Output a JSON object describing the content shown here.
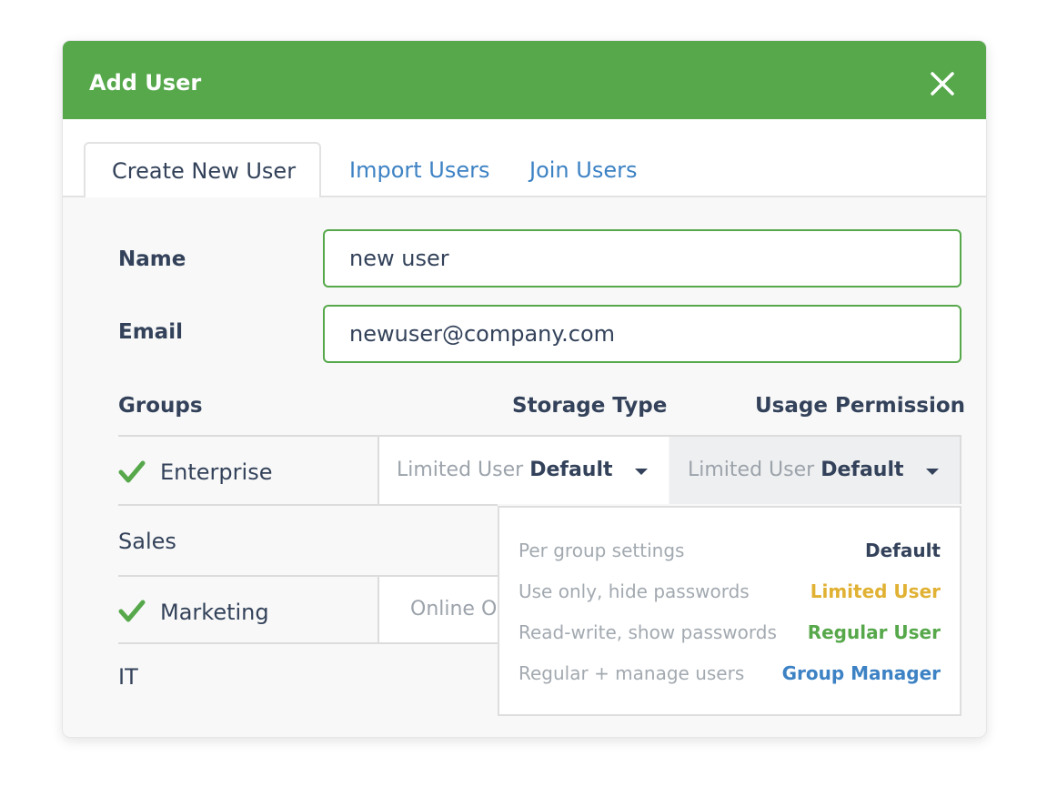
{
  "dialog": {
    "title": "Add User",
    "close_icon": "close-icon"
  },
  "tabs": [
    {
      "label": "Create New User",
      "active": true
    },
    {
      "label": "Import Users",
      "active": false
    },
    {
      "label": "Join Users",
      "active": false
    }
  ],
  "form": {
    "name_label": "Name",
    "name_value": "new user",
    "email_label": "Email",
    "email_value": "newuser@company.com"
  },
  "table": {
    "headers": {
      "groups": "Groups",
      "storage_type": "Storage Type",
      "usage_permission": "Usage Permission"
    },
    "rows": [
      {
        "name": "Enterprise",
        "checked": true,
        "storage": {
          "muted": "Limited User",
          "strong": "Default"
        },
        "permission": {
          "muted": "Limited User",
          "strong": "Default"
        }
      },
      {
        "name": "Sales",
        "checked": false
      },
      {
        "name": "Marketing",
        "checked": true,
        "storage": {
          "muted": "Online Or",
          "strong": ""
        }
      },
      {
        "name": "IT",
        "checked": false
      }
    ]
  },
  "permission_dropdown": {
    "options": [
      {
        "description": "Per group settings",
        "value": "Default",
        "color": "#33425a"
      },
      {
        "description": "Use only, hide passwords",
        "value": "Limited User",
        "color": "#e0b132"
      },
      {
        "description": "Read-write, show passwords",
        "value": "Regular User",
        "color": "#56a84b"
      },
      {
        "description": "Regular + manage users",
        "value": "Group Manager",
        "color": "#3d82c4"
      }
    ]
  },
  "colors": {
    "accent_green": "#56a84b",
    "link_blue": "#3d82c4",
    "text_dark": "#33425a",
    "text_muted": "#9ca3ab"
  },
  "icons": {
    "check": "check-icon",
    "caret": "caret-down-icon"
  }
}
